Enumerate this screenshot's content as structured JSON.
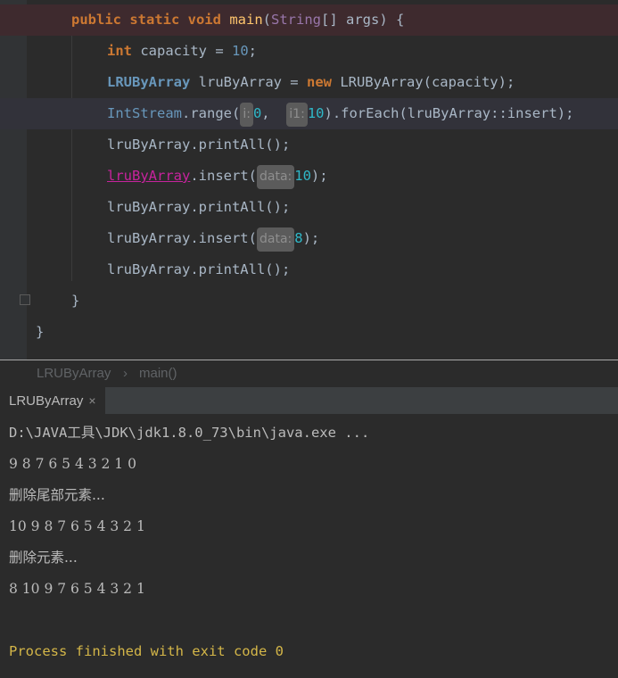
{
  "editor": {
    "lines": [
      {
        "kw1": "public static void",
        "fn": "main",
        "p1": "(",
        "type": "String",
        "p2": "[] args) {"
      },
      {
        "kw": "int",
        "rest": " capacity = ",
        "num": "10",
        "end": ";"
      },
      {
        "cls": "LRUByArray",
        "rest": " lruByArray = ",
        "kw": "new",
        "end": " LRUByArray(capacity);"
      },
      {
        "cls": "IntStream",
        "a": ".range(",
        "h1": "i:",
        "n1": "0",
        "b": ", ",
        "h2": "i1:",
        "n2": "10",
        "c": ").forEach(lruByArray::insert);"
      },
      {
        "text": "lruByArray.printAll();"
      },
      {
        "err": "lruByArray",
        "a": ".insert(",
        "h": "data:",
        "n": "10",
        "end": ");"
      },
      {
        "text": "lruByArray.printAll();"
      },
      {
        "a": "lruByArray.insert(",
        "h": "data:",
        "n": "8",
        "end": ");"
      },
      {
        "text": "lruByArray.printAll();"
      },
      {
        "text": "}"
      },
      {
        "text": "}"
      }
    ]
  },
  "breadcrumb": {
    "class": "LRUByArray",
    "sep": "›",
    "method": "main()"
  },
  "run": {
    "tab_label": "LRUByArray",
    "close": "×"
  },
  "console": {
    "lines": [
      "D:\\JAVA工具\\JDK\\jdk1.8.0_73\\bin\\java.exe ...",
      "9 8 7 6 5 4 3 2 1 0",
      "删除尾部元素...",
      "10 9 8 7 6 5 4 3 2 1",
      "删除元素...",
      "8 10 9 7 6 5 4 3 2 1",
      "",
      "Process finished with exit code 0"
    ]
  }
}
